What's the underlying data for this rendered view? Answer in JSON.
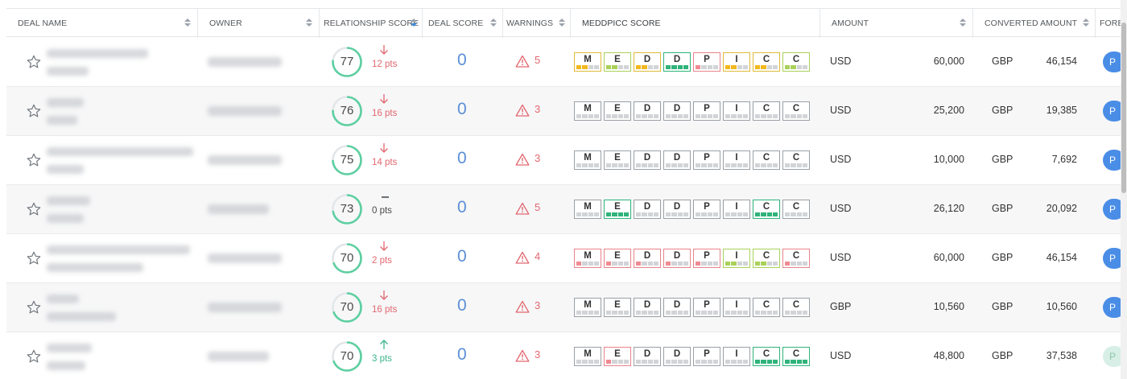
{
  "columns": [
    {
      "key": "deal_name",
      "label": "DEAL NAME"
    },
    {
      "key": "owner",
      "label": "OWNER"
    },
    {
      "key": "relationship_score",
      "label": "RELATIONSHIP SCORE"
    },
    {
      "key": "deal_score",
      "label": "DEAL SCORE"
    },
    {
      "key": "warnings",
      "label": "WARNINGS"
    },
    {
      "key": "meddpicc",
      "label": "MEDDPICC SCORE"
    },
    {
      "key": "amount",
      "label": "AMOUNT"
    },
    {
      "key": "converted_amount",
      "label": "CONVERTED AMOUNT"
    },
    {
      "key": "forecast",
      "label": "FORE"
    }
  ],
  "meddpicc_letters": [
    "M",
    "E",
    "D",
    "D",
    "P",
    "I",
    "C",
    "C"
  ],
  "colors": {
    "accent": "#3d8fe0",
    "ring": "#5ccfa0",
    "ring_track": "#e3e6e9",
    "down": "#e2676f",
    "up": "#3bb58a",
    "level": {
      "yellow": "#f2b81d",
      "lime": "#a9d15a",
      "green": "#2fb37a",
      "red": "#f08a92",
      "grey": "#d2d4d7"
    },
    "border": {
      "yellow": "#e0b93a",
      "lime": "#a9d15a",
      "green": "#2fb37a",
      "red": "#e8838b",
      "grey": "#9aa0a6"
    }
  },
  "rows": [
    {
      "rel_score": "77",
      "rel_value": 77,
      "trend": "down",
      "pts": "12 pts",
      "deal_score": "0",
      "warnings": "5",
      "meddpicc": [
        [
          "yellow",
          2
        ],
        [
          "lime",
          2
        ],
        [
          "yellow",
          2
        ],
        [
          "green",
          4
        ],
        [
          "red",
          1
        ],
        [
          "yellow",
          2
        ],
        [
          "yellow",
          2
        ],
        [
          "lime",
          2
        ]
      ],
      "amount_currency": "USD",
      "amount": "60,000",
      "conv_currency": "GBP",
      "conv_amount": "46,154",
      "forecast": "P"
    },
    {
      "rel_score": "76",
      "rel_value": 76,
      "trend": "down",
      "pts": "16 pts",
      "deal_score": "0",
      "warnings": "3",
      "meddpicc": [
        [
          "grey",
          0
        ],
        [
          "grey",
          0
        ],
        [
          "grey",
          0
        ],
        [
          "grey",
          0
        ],
        [
          "grey",
          0
        ],
        [
          "grey",
          0
        ],
        [
          "grey",
          0
        ],
        [
          "grey",
          0
        ]
      ],
      "amount_currency": "USD",
      "amount": "25,200",
      "conv_currency": "GBP",
      "conv_amount": "19,385",
      "forecast": "P"
    },
    {
      "rel_score": "75",
      "rel_value": 75,
      "trend": "down",
      "pts": "14 pts",
      "deal_score": "0",
      "warnings": "3",
      "meddpicc": [
        [
          "grey",
          0
        ],
        [
          "grey",
          0
        ],
        [
          "grey",
          0
        ],
        [
          "grey",
          0
        ],
        [
          "grey",
          0
        ],
        [
          "grey",
          0
        ],
        [
          "grey",
          0
        ],
        [
          "grey",
          0
        ]
      ],
      "amount_currency": "USD",
      "amount": "10,000",
      "conv_currency": "GBP",
      "conv_amount": "7,692",
      "forecast": "P"
    },
    {
      "rel_score": "73",
      "rel_value": 73,
      "trend": "flat",
      "pts": "0 pts",
      "deal_score": "0",
      "warnings": "5",
      "meddpicc": [
        [
          "grey",
          0
        ],
        [
          "green",
          4
        ],
        [
          "grey",
          0
        ],
        [
          "grey",
          0
        ],
        [
          "grey",
          0
        ],
        [
          "grey",
          0
        ],
        [
          "green",
          4
        ],
        [
          "grey",
          0
        ]
      ],
      "amount_currency": "USD",
      "amount": "26,120",
      "conv_currency": "GBP",
      "conv_amount": "20,092",
      "forecast": "P"
    },
    {
      "rel_score": "70",
      "rel_value": 70,
      "trend": "down",
      "pts": "2 pts",
      "deal_score": "0",
      "warnings": "4",
      "meddpicc": [
        [
          "red",
          1
        ],
        [
          "red",
          1
        ],
        [
          "red",
          1
        ],
        [
          "red",
          1
        ],
        [
          "red",
          1
        ],
        [
          "lime",
          2
        ],
        [
          "lime",
          2
        ],
        [
          "red",
          1
        ]
      ],
      "amount_currency": "USD",
      "amount": "60,000",
      "conv_currency": "GBP",
      "conv_amount": "46,154",
      "forecast": "P"
    },
    {
      "rel_score": "70",
      "rel_value": 70,
      "trend": "down",
      "pts": "16 pts",
      "deal_score": "0",
      "warnings": "3",
      "meddpicc": [
        [
          "grey",
          0
        ],
        [
          "grey",
          0
        ],
        [
          "grey",
          0
        ],
        [
          "grey",
          0
        ],
        [
          "grey",
          0
        ],
        [
          "grey",
          0
        ],
        [
          "grey",
          0
        ],
        [
          "grey",
          0
        ]
      ],
      "amount_currency": "GBP",
      "amount": "10,560",
      "conv_currency": "GBP",
      "conv_amount": "10,560",
      "forecast": "P"
    },
    {
      "rel_score": "70",
      "rel_value": 70,
      "trend": "up",
      "pts": "3 pts",
      "deal_score": "0",
      "warnings": "3",
      "meddpicc": [
        [
          "grey",
          0
        ],
        [
          "red",
          1
        ],
        [
          "grey",
          0
        ],
        [
          "grey",
          0
        ],
        [
          "grey",
          0
        ],
        [
          "grey",
          0
        ],
        [
          "green",
          4
        ],
        [
          "green",
          4
        ]
      ],
      "amount_currency": "USD",
      "amount": "48,800",
      "conv_currency": "GBP",
      "conv_amount": "37,538",
      "forecast": "P",
      "forecast_light": true
    }
  ]
}
